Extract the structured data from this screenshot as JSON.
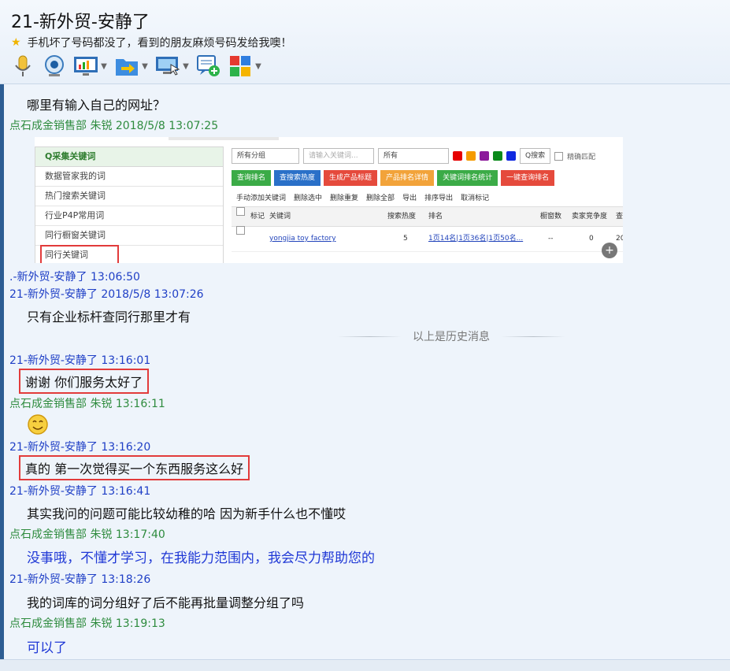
{
  "window": {
    "title": "21-新外贸-安静了",
    "signature": "手机坏了号码都没了，看到的朋友麻烦号码发给我噢！"
  },
  "toolbar": {
    "items": [
      "mic-icon",
      "webcam-icon",
      "screen-share-icon",
      "send-file-icon",
      "remote-desktop-icon",
      "message-icon",
      "apps-icon"
    ]
  },
  "embedded_screenshot": {
    "panel_title": "Q采集关键词",
    "panel_items": [
      "数据管家我的词",
      "热门搜索关键词",
      "行业P4P常用词",
      "同行橱窗关键词",
      "同行关键词"
    ],
    "group_select": "所有分组",
    "keyword_placeholder": "请输入关键词...",
    "all_select": "所有",
    "search_btn": "Q搜索",
    "exact_match": "精确匹配",
    "buttons": [
      "查询排名",
      "查搜索热度",
      "生成产品标题",
      "产品排名详情",
      "关键词排名统计",
      "一键查询排名"
    ],
    "actions": [
      "手动添加关键词",
      "删除选中",
      "删除重复",
      "删除全部",
      "导出",
      "排序导出",
      "取消标记"
    ],
    "columns": [
      "标记",
      "关键词",
      "搜索热度",
      "排名",
      "橱窗数",
      "卖家竞争度",
      "查"
    ],
    "row": {
      "keyword": "yongjia toy factory",
      "heat": "5",
      "rank": "1页14名|1页36名|1页50名...",
      "window": "--",
      "comp": "0",
      "extra": "20"
    }
  },
  "messages": [
    {
      "type": "text",
      "text": "哪里有输入自己的网址？"
    },
    {
      "type": "sender",
      "name": "点石成金销售部 朱锐 2018/5/8 13:07:25"
    },
    {
      "type": "sender",
      "name": ".-新外贸-安静了  13:06:50"
    },
    {
      "type": "sender",
      "name": "21-新外贸-安静了 2018/5/8 13:07:26"
    },
    {
      "type": "text",
      "text": "只有企业标杆查同行那里才有"
    },
    {
      "type": "divider",
      "text": "以上是历史消息"
    },
    {
      "type": "sender",
      "name": "21-新外贸-安静了  13:16:01"
    },
    {
      "type": "text",
      "text": "谢谢 你们服务太好了"
    },
    {
      "type": "sender",
      "name": "点石成金销售部 朱锐  13:16:11"
    },
    {
      "type": "sender",
      "name": "21-新外贸-安静了  13:16:20"
    },
    {
      "type": "text",
      "text": "真的 第一次觉得买一个东西服务这么好"
    },
    {
      "type": "sender",
      "name": "21-新外贸-安静了  13:16:41"
    },
    {
      "type": "text",
      "text": "其实我问的问题可能比较幼稚的哈 因为新手什么也不懂哎"
    },
    {
      "type": "sender",
      "name": "点石成金销售部 朱锐  13:17:40"
    },
    {
      "type": "text",
      "text": "没事哦，不懂才学习，在我能力范围内，我会尽力帮助您的"
    },
    {
      "type": "sender",
      "name": "21-新外贸-安静了  13:18:26"
    },
    {
      "type": "text",
      "text": "我的词库的词分组好了后不能再批量调整分组了吗"
    },
    {
      "type": "sender",
      "name": "点石成金销售部 朱锐  13:19:13"
    },
    {
      "type": "text",
      "text": "可以了"
    }
  ],
  "colors": {
    "seller": "#2e8b3e",
    "buyer": "#1f3fc6",
    "highlight": "#e23b3b"
  }
}
